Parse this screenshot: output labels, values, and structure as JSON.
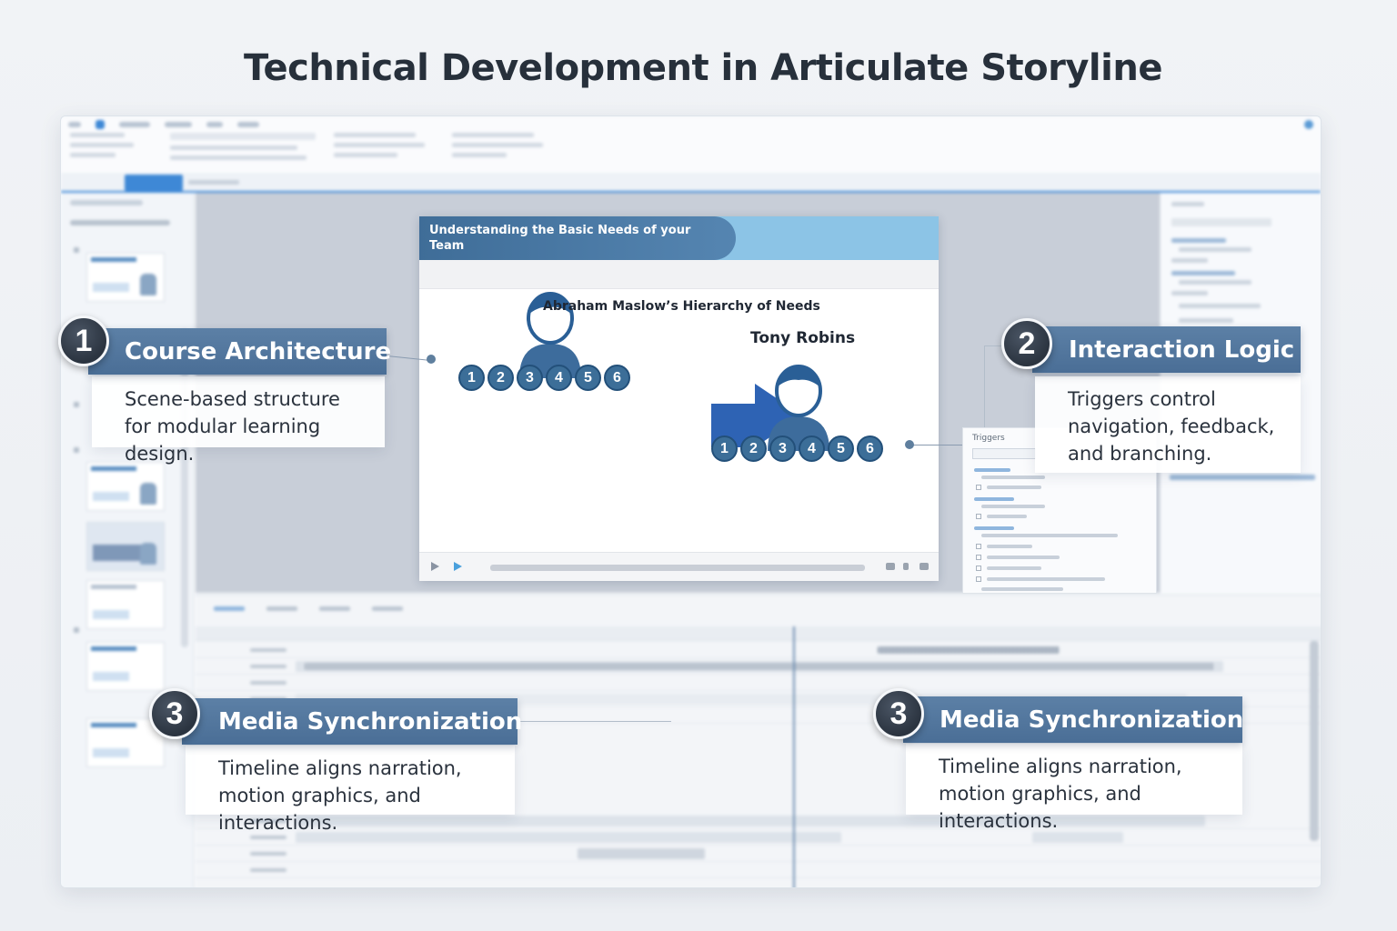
{
  "page": {
    "title": "Technical Development in Articulate Storyline"
  },
  "slide": {
    "header": "Understanding the Basic Needs of your Team",
    "text_maslow": "Abraham Maslow’s Hierarchy of Needs",
    "text_robins": "Tony Robins",
    "numbers": [
      "1",
      "2",
      "3",
      "4",
      "5",
      "6"
    ]
  },
  "trigger_panel": {
    "title": "Triggers"
  },
  "callouts": [
    {
      "number": "1",
      "title": "Course Architecture",
      "description_line1": "Scene-based structure",
      "description_line2": "for modular learning design."
    },
    {
      "number": "2",
      "title": "Interaction Logic",
      "description_line1": "Triggers control",
      "description_line2": "navigation, feedback,",
      "description_line3": "and branching."
    },
    {
      "number": "3",
      "title": "Media Synchronization",
      "description_line1": "Timeline aligns narration,",
      "description_line2": "motion graphics, and interactions."
    },
    {
      "number": "3",
      "title": "Media Synchronization",
      "description_line1": "Timeline aligns narration,",
      "description_line2": "motion graphics, and interactions."
    }
  ],
  "colors": {
    "accent": "#3e88d6",
    "callout_bar": "#4a6e96",
    "badge": "#2b3440",
    "slide_header": "#8cc4e6",
    "number_circle": "#3c6e98"
  },
  "icons": {
    "person": "person-icon",
    "arrow": "arrow-icon",
    "play": "play-icon"
  }
}
